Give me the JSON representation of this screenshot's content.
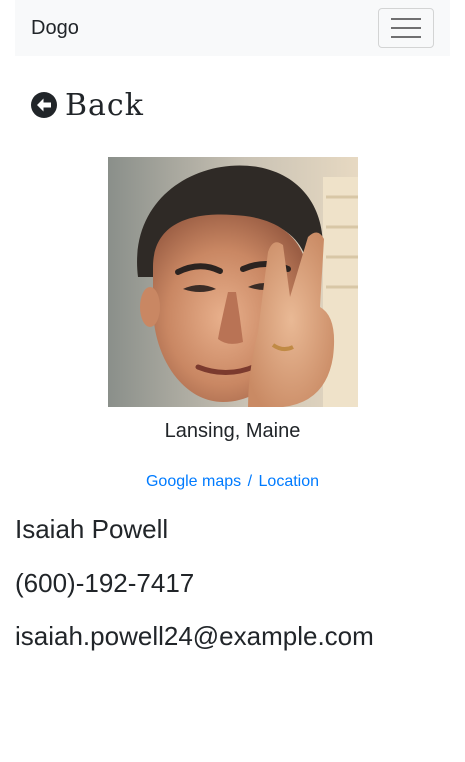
{
  "navbar": {
    "brand": "Dogo",
    "toggle_icon": "hamburger-icon"
  },
  "back": {
    "label": "Back",
    "icon": "arrow-circle-left-icon"
  },
  "profile": {
    "photo_alt": "profile-photo",
    "location": "Lansing, Maine",
    "maps_link": "Google maps",
    "maps_separator": "/",
    "location_link": "Location",
    "name": "Isaiah Powell",
    "phone": "(600)-192-7417",
    "email": "isaiah.powell24@example.com"
  },
  "colors": {
    "navbar_bg": "#f8f9fa",
    "link": "#007bff",
    "text": "#212529"
  }
}
